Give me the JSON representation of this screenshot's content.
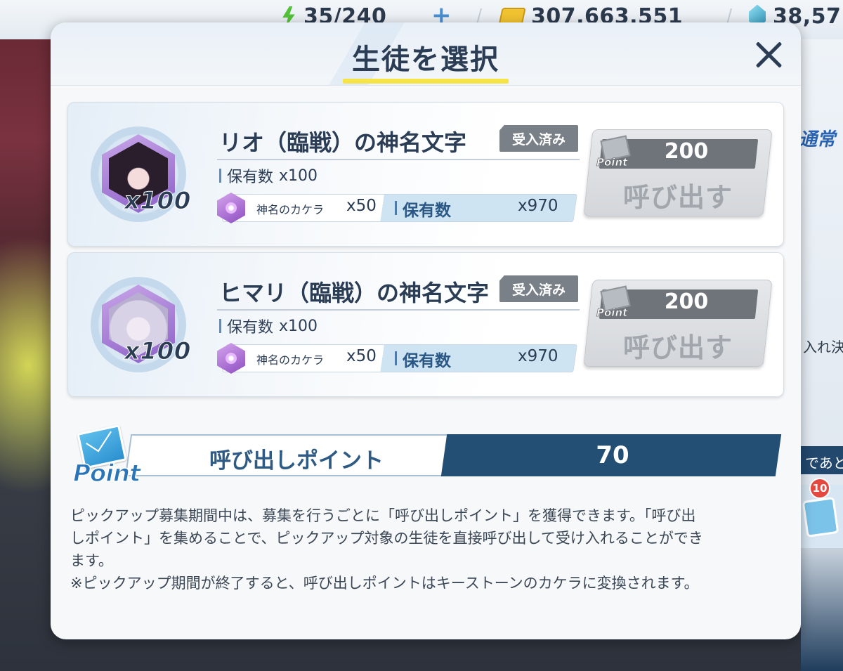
{
  "topbar": {
    "ap": "35/240",
    "credits": "307,663,551",
    "pyroxene": "38,57"
  },
  "background": {
    "right_label": "通常",
    "right_text_1": "入れ決",
    "right_bar_text": "であと",
    "mail_badge": "10"
  },
  "modal": {
    "title": "生徒を選択",
    "cards": [
      {
        "name": "リオ（臨戦）の神名文字",
        "badge": "受入済み",
        "portrait_qty": "x100",
        "owned_label": "保有数",
        "owned_value": "x100",
        "eleph_name": "神名のカケラ",
        "eleph_mult": "x50",
        "eleph_owned_label": "保有数",
        "eleph_owned_value": "x970",
        "cost": "200",
        "point_icon_text": "Point",
        "button_label": "呼び出す"
      },
      {
        "name": "ヒマリ（臨戦）の神名文字",
        "badge": "受入済み",
        "portrait_qty": "x100",
        "owned_label": "保有数",
        "owned_value": "x100",
        "eleph_name": "神名のカケラ",
        "eleph_mult": "x50",
        "eleph_owned_label": "保有数",
        "eleph_owned_value": "x970",
        "cost": "200",
        "point_icon_text": "Point",
        "button_label": "呼び出す"
      }
    ],
    "points": {
      "icon_text": "Point",
      "label": "呼び出しポイント",
      "value": "70"
    },
    "description": {
      "line1": "ピックアップ募集期間中は、募集を行うごとに「呼び出しポイント」を獲得できます。「呼び出",
      "line2": "しポイント」を集めることで、ピックアップ対象の生徒を直接呼び出して受け入れることができ",
      "line3": "ます。",
      "line4": "※ピックアップ期間が終了すると、呼び出しポイントはキーストーンのカケラに変換されます。"
    }
  }
}
